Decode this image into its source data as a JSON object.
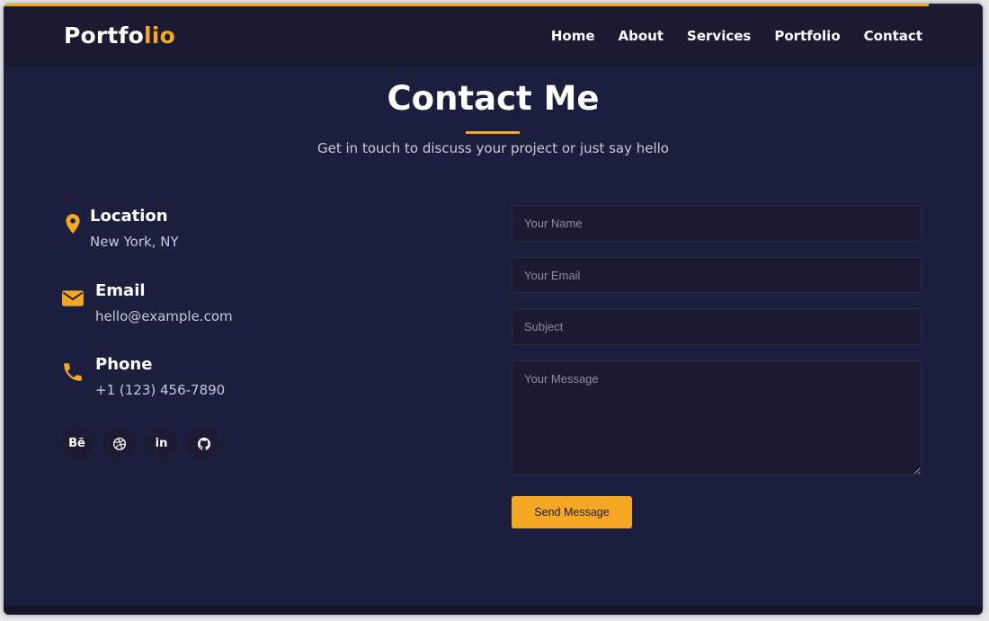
{
  "colors": {
    "accent": "#f6a825",
    "background": "#1b1f3d",
    "navbar": "#1b1a31"
  },
  "brand": {
    "part1": "Portfo",
    "part2": "lio"
  },
  "nav": [
    "Home",
    "About",
    "Services",
    "Portfolio",
    "Contact"
  ],
  "header": {
    "title": "Contact Me",
    "subtitle": "Get in touch to discuss your project or just say hello"
  },
  "contact_info": [
    {
      "icon": "location-pin-icon",
      "label": "Location",
      "value": "New York, NY"
    },
    {
      "icon": "envelope-icon",
      "label": "Email",
      "value": "hello@example.com"
    },
    {
      "icon": "phone-icon",
      "label": "Phone",
      "value": "+1 (123) 456-7890"
    }
  ],
  "socials": [
    {
      "icon": "behance-icon",
      "glyph": "Bē"
    },
    {
      "icon": "dribbble-icon",
      "glyph": ""
    },
    {
      "icon": "linkedin-icon",
      "glyph": "in"
    },
    {
      "icon": "github-icon",
      "glyph": ""
    }
  ],
  "form": {
    "name_placeholder": "Your Name",
    "email_placeholder": "Your Email",
    "subject_placeholder": "Subject",
    "message_placeholder": "Your Message",
    "submit_label": "Send Message"
  }
}
